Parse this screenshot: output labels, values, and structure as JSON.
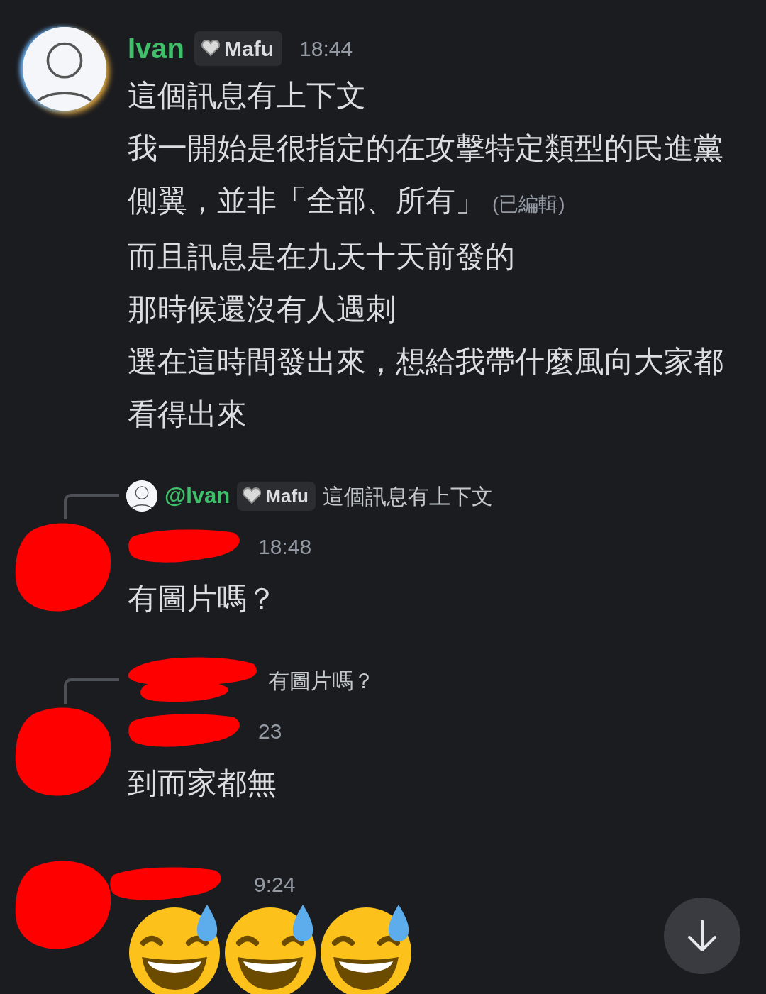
{
  "messages": [
    {
      "kind": "full",
      "author": "Ivan",
      "role": "Mafu",
      "time": "18:44",
      "redacted": false,
      "lines": [
        {
          "text": "這個訊息有上下文"
        },
        {
          "text": "我一開始是很指定的在攻擊特定類型的民進黨側翼，並非「全部、所有」",
          "edited": "(已編輯)"
        },
        {
          "text": "而且訊息是在九天十天前發的"
        },
        {
          "text": "那時候還沒有人遇刺"
        },
        {
          "text": "選在這時間發出來，想給我帶什麼風向大家都看得出來"
        }
      ]
    },
    {
      "kind": "reply",
      "reply": {
        "author": "@Ivan",
        "role": "Mafu",
        "text": "這個訊息有上下文",
        "redacted": false
      },
      "time": "18:48",
      "redacted": true,
      "lines": [
        {
          "text": "有圖片嗎？"
        }
      ]
    },
    {
      "kind": "reply",
      "reply": {
        "text": "有圖片嗎？",
        "redacted": true
      },
      "time": "23",
      "redacted": true,
      "lines": [
        {
          "text": "到而家都無"
        }
      ]
    },
    {
      "kind": "emoji",
      "time": "9:24",
      "redacted": true,
      "emojis": [
        {
          "kind": "grin-sweat"
        },
        {
          "kind": "grin-sweat"
        },
        {
          "kind": "grin-sweat"
        }
      ]
    }
  ]
}
